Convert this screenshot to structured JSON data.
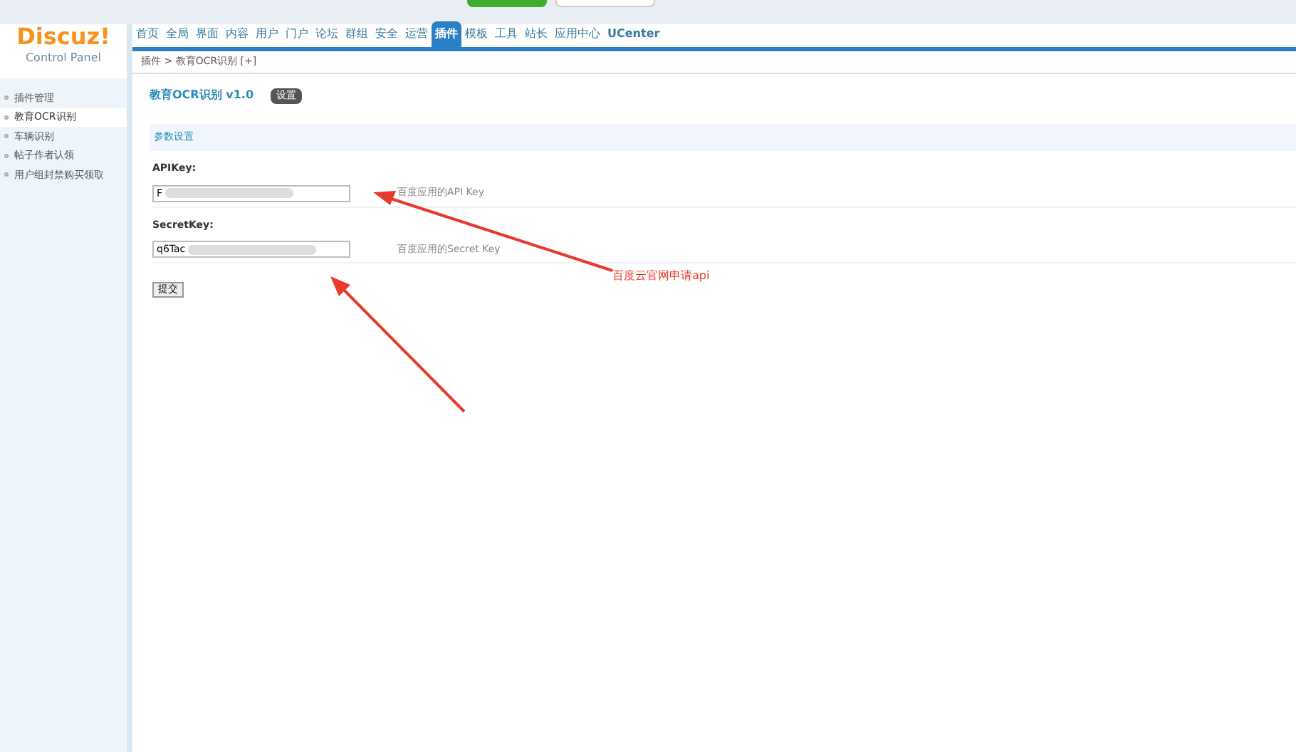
{
  "logo": {
    "title": "Discuz!",
    "subtitle": "Control Panel"
  },
  "nav": [
    {
      "label": "首页",
      "selected": false
    },
    {
      "label": "全局",
      "selected": false
    },
    {
      "label": "界面",
      "selected": false
    },
    {
      "label": "内容",
      "selected": false
    },
    {
      "label": "用户",
      "selected": false
    },
    {
      "label": "门户",
      "selected": false
    },
    {
      "label": "论坛",
      "selected": false
    },
    {
      "label": "群组",
      "selected": false
    },
    {
      "label": "安全",
      "selected": false
    },
    {
      "label": "运营",
      "selected": false
    },
    {
      "label": "插件",
      "selected": true
    },
    {
      "label": "模板",
      "selected": false
    },
    {
      "label": "工具",
      "selected": false
    },
    {
      "label": "站长",
      "selected": false
    },
    {
      "label": "应用中心",
      "selected": false
    },
    {
      "label": "UCenter",
      "selected": false
    }
  ],
  "breadcrumb": "插件 > 教育OCR识别 [+]",
  "sidebar": {
    "items": [
      {
        "label": "插件管理",
        "selected": false
      },
      {
        "label": "教育OCR识别",
        "selected": true
      },
      {
        "label": "车辆识别",
        "selected": false
      },
      {
        "label": "帖子作者认领",
        "selected": false
      },
      {
        "label": "用户组封禁购买领取",
        "selected": false
      }
    ]
  },
  "page_title": "教育OCR识别 v1.0",
  "settings_button": "设置",
  "section_title": "参数设置",
  "fields": [
    {
      "label": "APIKey:",
      "value": "F",
      "hint": "百度应用的API Key"
    },
    {
      "label": "SecretKey:",
      "value": "q6Tac",
      "hint": "百度应用的Secret Key"
    }
  ],
  "submit_button": "提交",
  "annotation": "百度云官网申请api"
}
